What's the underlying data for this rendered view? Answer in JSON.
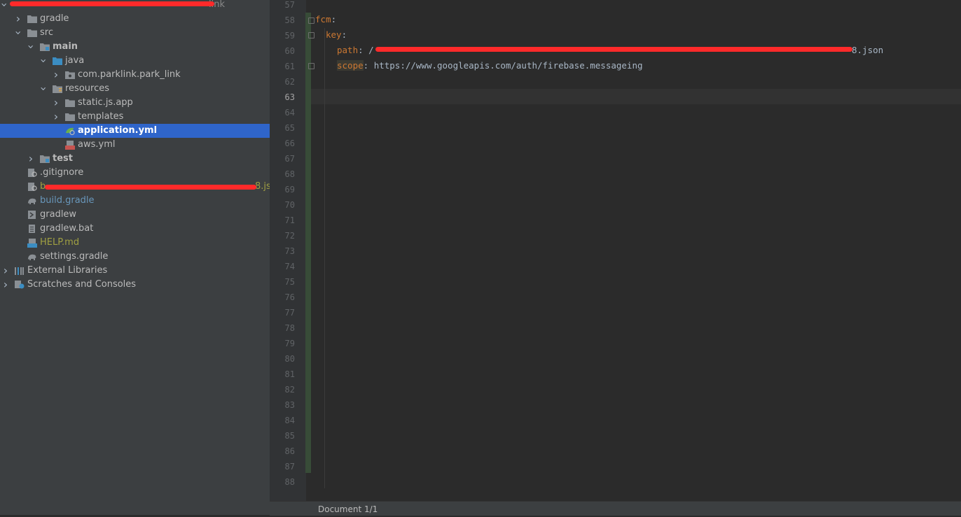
{
  "tree": {
    "root_label": "link",
    "items": [
      {
        "label": "gradle"
      },
      {
        "label": "src"
      },
      {
        "label": "main"
      },
      {
        "label": "java"
      },
      {
        "label": "com.parklink.park_link"
      },
      {
        "label": "resources"
      },
      {
        "label": "static.js.app"
      },
      {
        "label": "templates"
      },
      {
        "label": "application.yml"
      },
      {
        "label": "aws.yml"
      },
      {
        "label": "test"
      },
      {
        "label": ".gitignore"
      },
      {
        "label": "b",
        "suffix": "8.js"
      },
      {
        "label": "build.gradle"
      },
      {
        "label": "gradlew"
      },
      {
        "label": "gradlew.bat"
      },
      {
        "label": "HELP.md"
      },
      {
        "label": "settings.gradle"
      },
      {
        "label": "External Libraries"
      },
      {
        "label": "Scratches and Consoles"
      }
    ]
  },
  "editor": {
    "line_numbers": [
      "57",
      "58",
      "59",
      "60",
      "61",
      "62",
      "63",
      "64",
      "65",
      "66",
      "67",
      "68",
      "69",
      "70",
      "71",
      "72",
      "73",
      "74",
      "75",
      "76",
      "77",
      "78",
      "79",
      "80",
      "81",
      "82",
      "83",
      "84",
      "85",
      "86",
      "87",
      "88"
    ],
    "current_line": "63",
    "code": {
      "fcm_key": "fcm",
      "colon": ":",
      "key_key": "key",
      "path_key": "path",
      "path_prefix": " /",
      "path_suffix": "8.json",
      "scope_key": "scope",
      "scope_value": " https://www.googleapis.com/auth/firebase.messageing"
    }
  },
  "status": {
    "document": "Document 1/1"
  },
  "colors": {
    "tree_bg": "#3c3f41",
    "selection": "#2f65ca",
    "editor_bg": "#2b2b2b",
    "yaml_key": "#cc7832",
    "redaction": "#ff2a2a"
  }
}
